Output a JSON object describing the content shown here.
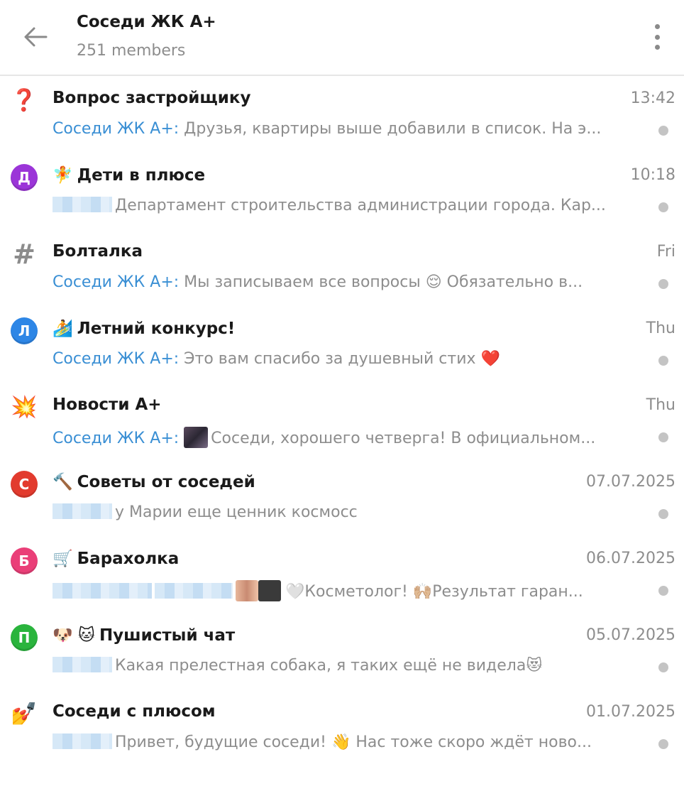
{
  "header": {
    "title": "Соседи ЖК А+",
    "subtitle": "251 members"
  },
  "topics": [
    {
      "icon": "❓",
      "icon_name": "question-mark-icon",
      "name_emoji": "",
      "name": "Вопрос застройщику",
      "time": "13:42",
      "sender": "Соседи ЖК А+:",
      "preview": "Друзья, квартиры выше добавили в список. На э...",
      "blurred_sender": false
    },
    {
      "icon": "Д",
      "icon_color": "#9b35d8",
      "icon_name": "letter-d-icon",
      "name_emoji": "🧚",
      "name": "Дети в плюсе",
      "time": "10:18",
      "sender": "",
      "preview": "Департамент строительства администрации города. Кар...",
      "blurred_sender": true
    },
    {
      "icon": "#",
      "icon_name": "hashtag-icon",
      "name_emoji": "",
      "name": "Болталка",
      "time": "Fri",
      "sender": "Соседи ЖК А+:",
      "preview": "Мы записываем все вопросы 😌 Обязательно в...",
      "blurred_sender": false
    },
    {
      "icon": "Л",
      "icon_color": "#2d86e6",
      "icon_name": "letter-l-icon",
      "name_emoji": "🏄",
      "name": "Летний конкурс!",
      "time": "Thu",
      "sender": "Соседи ЖК А+:",
      "preview": "Это вам спасибо за душевный стих ❤️",
      "blurred_sender": false
    },
    {
      "icon": "💥",
      "icon_name": "collision-icon",
      "name_emoji": "",
      "name": "Новости А+",
      "time": "Thu",
      "sender": "Соседи ЖК А+:",
      "preview": "Соседи, хорошего четверга!  В официальном...",
      "blurred_sender": false,
      "has_thumb": true
    },
    {
      "icon": "С",
      "icon_color": "#e23b2e",
      "icon_name": "letter-s-icon",
      "name_emoji": "🔨",
      "name": "Советы от соседей",
      "time": "07.07.2025",
      "sender": "",
      "preview": "у Марии еще ценник космосс",
      "blurred_sender": true
    },
    {
      "icon": "Б",
      "icon_color": "#ea3f78",
      "icon_name": "letter-b-icon",
      "name_emoji": "🛒",
      "name": "Барахолка",
      "time": "06.07.2025",
      "sender": "",
      "preview": "🤍Косметолог!   🙌🏼Результат гаран...",
      "blurred_sender": true,
      "long_blur": true
    },
    {
      "icon": "П",
      "icon_color": "#2ab43d",
      "icon_name": "letter-p-icon",
      "name_emoji": "🐶 🐱",
      "name": "Пушистый чат",
      "time": "05.07.2025",
      "sender": "",
      "preview": "Какая прелестная собака, я таких ещё не видела😻",
      "blurred_sender": true
    },
    {
      "icon": "💅",
      "icon_name": "nail-polish-icon",
      "name_emoji": "",
      "name": "Соседи с плюсом",
      "time": "01.07.2025",
      "sender": "",
      "preview": "Привет, будущие соседи! 👋 Нас тоже скоро ждёт ново...",
      "blurred_sender": true
    }
  ]
}
